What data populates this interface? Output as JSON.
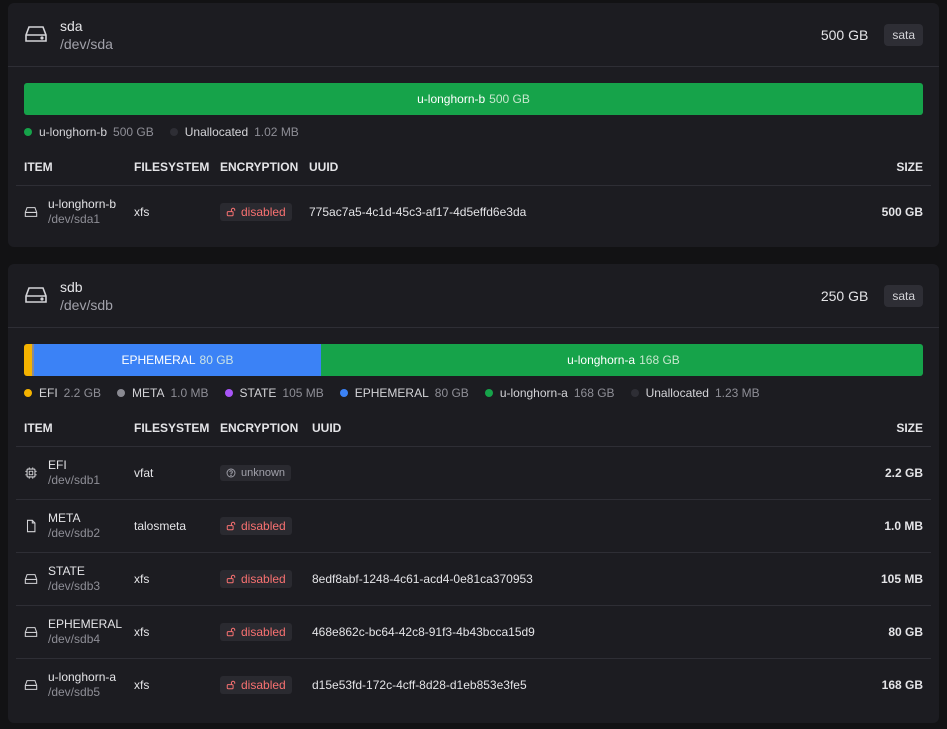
{
  "colors": {
    "efi": "#f5b300",
    "meta": "#8a8a92",
    "state": "#a855f7",
    "ephemeral": "#3b82f6",
    "longhorn": "#16a34a",
    "unallocated": "#2e2e35"
  },
  "disks": [
    {
      "name": "sda",
      "path": "/dev/sda",
      "size": "500 GB",
      "bus": "sata",
      "bar": [
        {
          "label": "u-longhorn-b",
          "size": "500 GB",
          "fraction": 1.0,
          "color": "#16a34a"
        }
      ],
      "legend": [
        {
          "label": "u-longhorn-b",
          "size": "500 GB",
          "color": "#16a34a"
        },
        {
          "label": "Unallocated",
          "size": "1.02 MB",
          "color": "#2e2e35"
        }
      ],
      "columns": [
        "ITEM",
        "FILESYSTEM",
        "ENCRYPTION",
        "UUID",
        "SIZE"
      ],
      "rows": [
        {
          "name": "u-longhorn-b",
          "path": "/dev/sda1",
          "icon": "drive-icon",
          "filesystem": "xfs",
          "encryption": "disabled",
          "uuid": "775ac7a5-4c1d-45c3-af17-4d5effd6e3da",
          "size": "500 GB"
        }
      ]
    },
    {
      "name": "sdb",
      "path": "/dev/sdb",
      "size": "250 GB",
      "bus": "sata",
      "bar": [
        {
          "label": "",
          "size": "",
          "fraction": 0.0088,
          "color": "#f5b300"
        },
        {
          "label": "",
          "size": "",
          "fraction": 0.002,
          "color": "#8a8a92"
        },
        {
          "label": "EPHEMERAL",
          "size": "80 GB",
          "fraction": 0.32,
          "color": "#3b82f6"
        },
        {
          "label": "u-longhorn-a",
          "size": "168 GB",
          "fraction": 0.672,
          "color": "#16a34a"
        }
      ],
      "legend": [
        {
          "label": "EFI",
          "size": "2.2 GB",
          "color": "#f5b300"
        },
        {
          "label": "META",
          "size": "1.0 MB",
          "color": "#8a8a92"
        },
        {
          "label": "STATE",
          "size": "105 MB",
          "color": "#a855f7"
        },
        {
          "label": "EPHEMERAL",
          "size": "80 GB",
          "color": "#3b82f6"
        },
        {
          "label": "u-longhorn-a",
          "size": "168 GB",
          "color": "#16a34a"
        },
        {
          "label": "Unallocated",
          "size": "1.23 MB",
          "color": "#2e2e35"
        }
      ],
      "columns": [
        "ITEM",
        "FILESYSTEM",
        "ENCRYPTION",
        "UUID",
        "SIZE"
      ],
      "rows": [
        {
          "name": "EFI",
          "path": "/dev/sdb1",
          "icon": "chip-icon",
          "filesystem": "vfat",
          "encryption": "unknown",
          "uuid": "",
          "size": "2.2 GB"
        },
        {
          "name": "META",
          "path": "/dev/sdb2",
          "icon": "file-icon",
          "filesystem": "talosmeta",
          "encryption": "disabled",
          "uuid": "",
          "size": "1.0 MB"
        },
        {
          "name": "STATE",
          "path": "/dev/sdb3",
          "icon": "drive-icon",
          "filesystem": "xfs",
          "encryption": "disabled",
          "uuid": "8edf8abf-1248-4c61-acd4-0e81ca370953",
          "size": "105 MB"
        },
        {
          "name": "EPHEMERAL",
          "path": "/dev/sdb4",
          "icon": "drive-icon",
          "filesystem": "xfs",
          "encryption": "disabled",
          "uuid": "468e862c-bc64-42c8-91f3-4b43bcca15d9",
          "size": "80 GB"
        },
        {
          "name": "u-longhorn-a",
          "path": "/dev/sdb5",
          "icon": "drive-icon",
          "filesystem": "xfs",
          "encryption": "disabled",
          "uuid": "d15e53fd-172c-4cff-8d28-d1eb853e3fe5",
          "size": "168 GB"
        }
      ]
    }
  ]
}
